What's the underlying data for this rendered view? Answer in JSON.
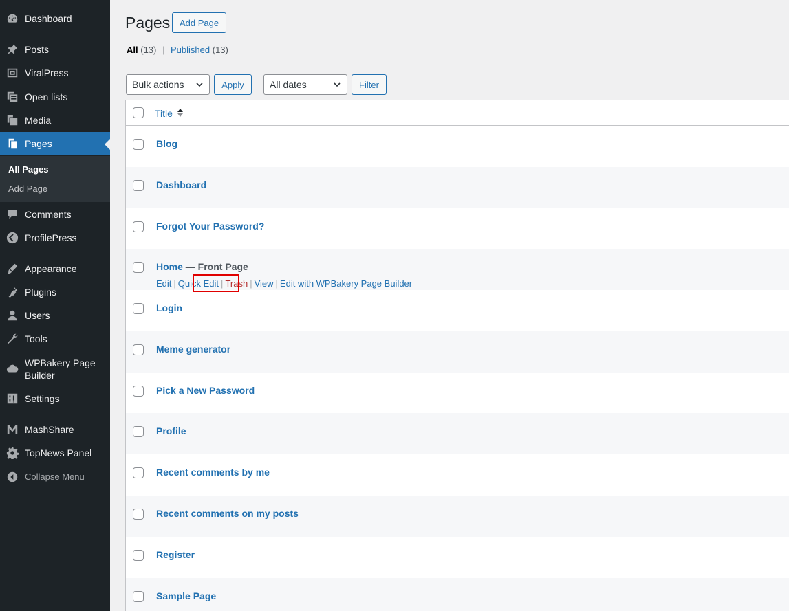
{
  "sidebar": {
    "items": [
      {
        "label": "Dashboard",
        "icon": "dashboard-icon"
      },
      {
        "label": "Posts",
        "icon": "pin-icon"
      },
      {
        "label": "ViralPress",
        "icon": "viralpress-icon"
      },
      {
        "label": "Open lists",
        "icon": "open-lists-icon"
      },
      {
        "label": "Media",
        "icon": "media-icon"
      },
      {
        "label": "Pages",
        "icon": "pages-icon"
      },
      {
        "label": "Comments",
        "icon": "comment-icon"
      },
      {
        "label": "ProfilePress",
        "icon": "profilepress-icon"
      },
      {
        "label": "Appearance",
        "icon": "appearance-icon"
      },
      {
        "label": "Plugins",
        "icon": "plugin-icon"
      },
      {
        "label": "Users",
        "icon": "users-icon"
      },
      {
        "label": "Tools",
        "icon": "wrench-icon"
      },
      {
        "label": "WPBakery Page Builder",
        "icon": "cloud-icon"
      },
      {
        "label": "Settings",
        "icon": "settings-icon"
      },
      {
        "label": "MashShare",
        "icon": "mashshare-icon"
      },
      {
        "label": "TopNews Panel",
        "icon": "gear-icon"
      },
      {
        "label": "Collapse Menu",
        "icon": "collapse-icon"
      }
    ],
    "submenu": {
      "all_pages": "All Pages",
      "add_page": "Add Page"
    }
  },
  "header": {
    "title": "Pages",
    "add_button": "Add Page"
  },
  "filters": {
    "all_label": "All",
    "all_count": "(13)",
    "published_label": "Published",
    "published_count": "(13)",
    "separator": "|"
  },
  "toolbar": {
    "bulk_actions": "Bulk actions",
    "apply": "Apply",
    "all_dates": "All dates",
    "filter": "Filter"
  },
  "table": {
    "column_title": "Title",
    "rows": [
      {
        "title": "Blog"
      },
      {
        "title": "Dashboard"
      },
      {
        "title": "Forgot Your Password?"
      },
      {
        "title": "Home",
        "state": " — Front Page"
      },
      {
        "title": "Login"
      },
      {
        "title": "Meme generator"
      },
      {
        "title": "Pick a New Password"
      },
      {
        "title": "Profile"
      },
      {
        "title": "Recent comments by me"
      },
      {
        "title": "Recent comments on my posts"
      },
      {
        "title": "Register"
      },
      {
        "title": "Sample Page"
      }
    ],
    "row_actions": {
      "edit": "Edit",
      "quick_edit": "Quick Edit",
      "trash": "Trash",
      "view": "View",
      "edit_wpbakery": "Edit with WPBakery Page Builder",
      "sep": "|"
    }
  },
  "colors": {
    "accent": "#2271b1",
    "sidebar_bg": "#1d2327",
    "highlight": "#e00000",
    "trash": "#b32d2e"
  }
}
